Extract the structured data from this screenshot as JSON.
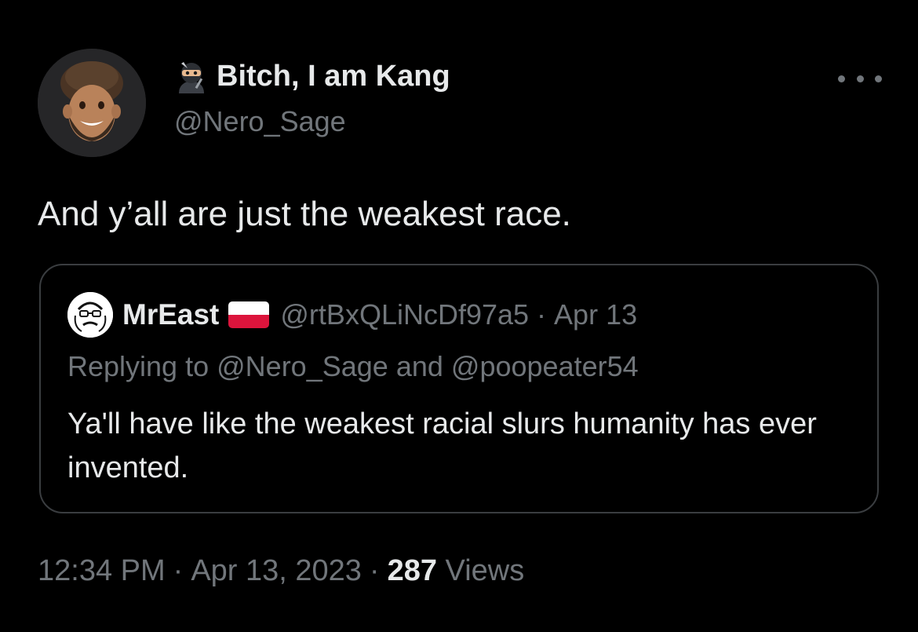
{
  "author": {
    "display_name": "Bitch, I am Kang",
    "handle": "@Nero_Sage",
    "name_prefix_icon": "ninja-emoji-icon",
    "avatar": "memoji-avatar"
  },
  "tweet": {
    "text": "And y’all are just the weakest race."
  },
  "quote": {
    "name": "MrEast",
    "flag_icon": "poland-flag-icon",
    "handle": "@rtBxQLiNcDf97a5",
    "separator": "·",
    "date": "Apr 13",
    "replying_prefix": "Replying to",
    "replying_to": [
      "@Nero_Sage",
      "@poopeater54"
    ],
    "replying_joiner": "and",
    "text": "Ya'll have like the weakest racial slurs humanity has ever invented."
  },
  "meta": {
    "time": "12:34 PM",
    "separator": "·",
    "date": "Apr 13, 2023",
    "views_count": "287",
    "views_label": "Views"
  },
  "colors": {
    "background": "#000000",
    "primary_text": "#e7e9ea",
    "secondary_text": "#71767b",
    "card_border": "#3a3d40"
  }
}
